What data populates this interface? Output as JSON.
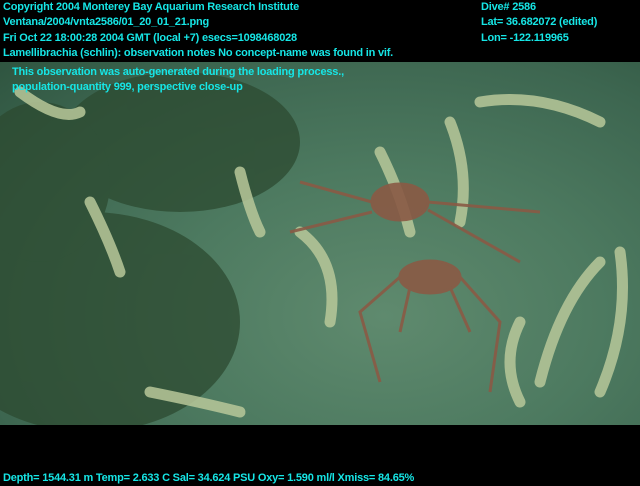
{
  "header_left": {
    "copyright": "Copyright 2004 Monterey Bay Aquarium Research Institute",
    "file_path": "Ventana/2004/vnta2586/01_20_01_21.png",
    "timestamp": "Fri Oct 22 18:00:28 2004 GMT (local +7)  esecs=1098468028",
    "concept": "Lamellibrachia (schlin): observation notes No concept-name was found in vif.",
    "notes_line1": "This observation was auto-generated during the loading process.,",
    "notes_line2": "population-quantity 999, perspective close-up"
  },
  "header_right": {
    "dive": "Dive# 2586",
    "lat": "Lat= 36.682072 (edited)",
    "lon": "Lon= -122.119965"
  },
  "footer": {
    "sensors": "Depth= 1544.31 m  Temp= 2.633 C  Sal= 34.624 PSU  Oxy= 1.590 ml/l  Xmiss= 84.65%"
  },
  "colors": {
    "overlay_text": "#16e6e6",
    "seafloor": "#4d7a60"
  }
}
